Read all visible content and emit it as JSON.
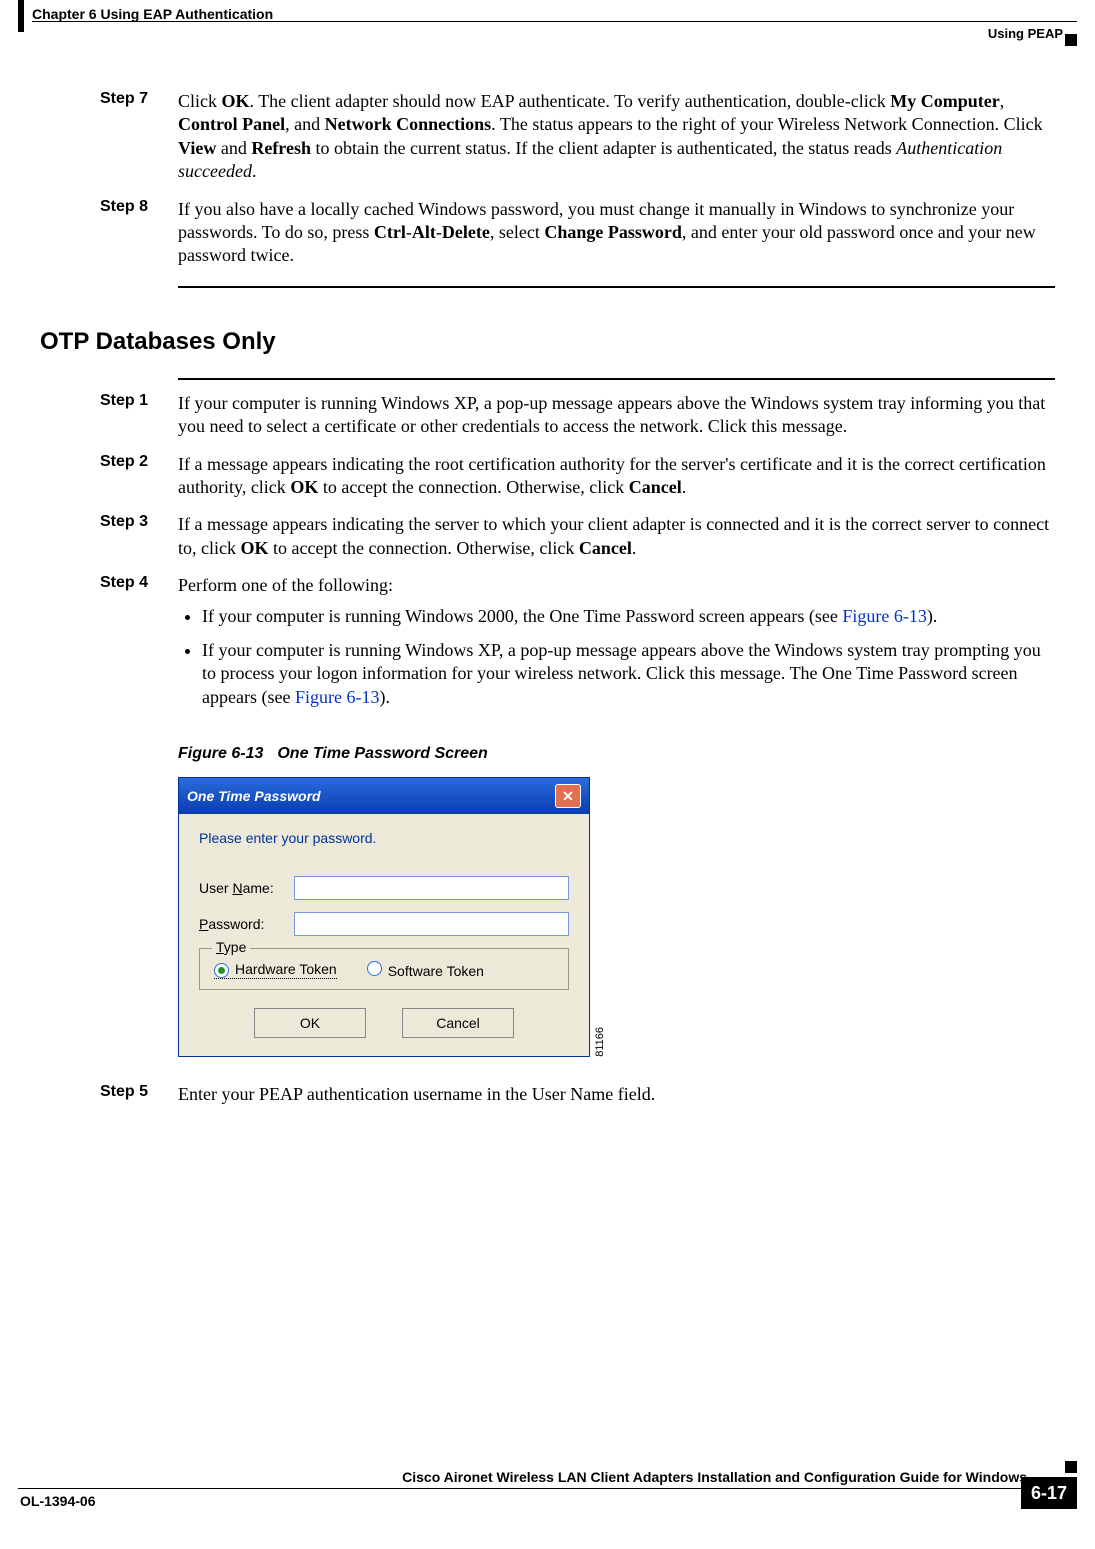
{
  "header": {
    "chapter_line": "Chapter 6      Using EAP Authentication",
    "right_sub": "Using PEAP"
  },
  "steps_top": [
    {
      "label": "Step 7",
      "parts": [
        {
          "t": "Click "
        },
        {
          "t": "OK",
          "b": true
        },
        {
          "t": ". The client adapter should now EAP authenticate. To verify authentication, double-click "
        },
        {
          "t": "My Computer",
          "b": true
        },
        {
          "t": ", "
        },
        {
          "t": "Control Panel",
          "b": true
        },
        {
          "t": ", and "
        },
        {
          "t": "Network Connections",
          "b": true
        },
        {
          "t": ". The status appears to the right of your Wireless Network Connection. Click "
        },
        {
          "t": "View",
          "b": true
        },
        {
          "t": " and "
        },
        {
          "t": "Refresh",
          "b": true
        },
        {
          "t": " to obtain the current status. If the client adapter is authenticated, the status reads "
        },
        {
          "t": "Authentication succeeded",
          "i": true
        },
        {
          "t": "."
        }
      ]
    },
    {
      "label": "Step 8",
      "parts": [
        {
          "t": "If you also have a locally cached Windows password, you must change it manually in Windows to synchronize your passwords. To do so, press "
        },
        {
          "t": "Ctrl",
          "b": true
        },
        {
          "t": "-"
        },
        {
          "t": "Alt",
          "b": true
        },
        {
          "t": "-"
        },
        {
          "t": "Delete",
          "b": true
        },
        {
          "t": ", select "
        },
        {
          "t": "Change Password",
          "b": true
        },
        {
          "t": ", and enter your old password once and your new password twice."
        }
      ]
    }
  ],
  "section_title": "OTP Databases Only",
  "steps_otp": [
    {
      "label": "Step 1",
      "parts": [
        {
          "t": "If your computer is running Windows XP, a pop-up message appears above the Windows system tray informing you that you need to select a certificate or other credentials to access the network. Click this message."
        }
      ]
    },
    {
      "label": "Step 2",
      "parts": [
        {
          "t": "If a message appears indicating the root certification authority for the server's certificate and it is the correct certification authority, click "
        },
        {
          "t": "OK",
          "b": true
        },
        {
          "t": " to accept the connection. Otherwise, click "
        },
        {
          "t": "Cancel",
          "b": true
        },
        {
          "t": "."
        }
      ]
    },
    {
      "label": "Step 3",
      "parts": [
        {
          "t": "If a message appears indicating the server to which your client adapter is connected and it is the correct server to connect to, click "
        },
        {
          "t": "OK",
          "b": true
        },
        {
          "t": " to accept the connection. Otherwise, click "
        },
        {
          "t": "Cancel",
          "b": true
        },
        {
          "t": "."
        }
      ]
    },
    {
      "label": "Step 4",
      "parts": [
        {
          "t": "Perform one of the following:"
        }
      ],
      "bullets": [
        {
          "parts": [
            {
              "t": "If your computer is running Windows 2000, the One Time Password screen appears (see "
            },
            {
              "t": "Figure 6-13",
              "link": true
            },
            {
              "t": ")."
            }
          ]
        },
        {
          "parts": [
            {
              "t": "If your computer is running Windows XP, a pop-up message appears above the Windows system tray prompting you to process your logon information for your wireless network. Click this message. The One Time Password screen appears (see "
            },
            {
              "t": "Figure 6-13",
              "link": true
            },
            {
              "t": ")."
            }
          ]
        }
      ]
    }
  ],
  "figure": {
    "number": "Figure 6-13",
    "title": "One Time Password Screen",
    "side_tag": "81166"
  },
  "dialog": {
    "title": "One Time Password",
    "message": "Please enter your password.",
    "user_label_pre": "User ",
    "user_label_ul": "N",
    "user_label_post": "ame:",
    "pass_label_ul": "P",
    "pass_label_post": "assword:",
    "group_ul": "T",
    "group_post": "ype",
    "radio_hw_ul": "H",
    "radio_hw_post": "ardware Token",
    "radio_sw_ul": "S",
    "radio_sw_post": "oftware Token",
    "ok_ul": "O",
    "ok_post": "K",
    "cancel_ul": "C",
    "cancel_post": "ancel"
  },
  "step5": {
    "label": "Step 5",
    "text": "Enter your PEAP authentication username in the User Name field."
  },
  "footer": {
    "book_title": "Cisco Aironet Wireless LAN Client Adapters Installation and Configuration Guide for Windows",
    "doc_id": "OL-1394-06",
    "page_no": "6-17"
  }
}
